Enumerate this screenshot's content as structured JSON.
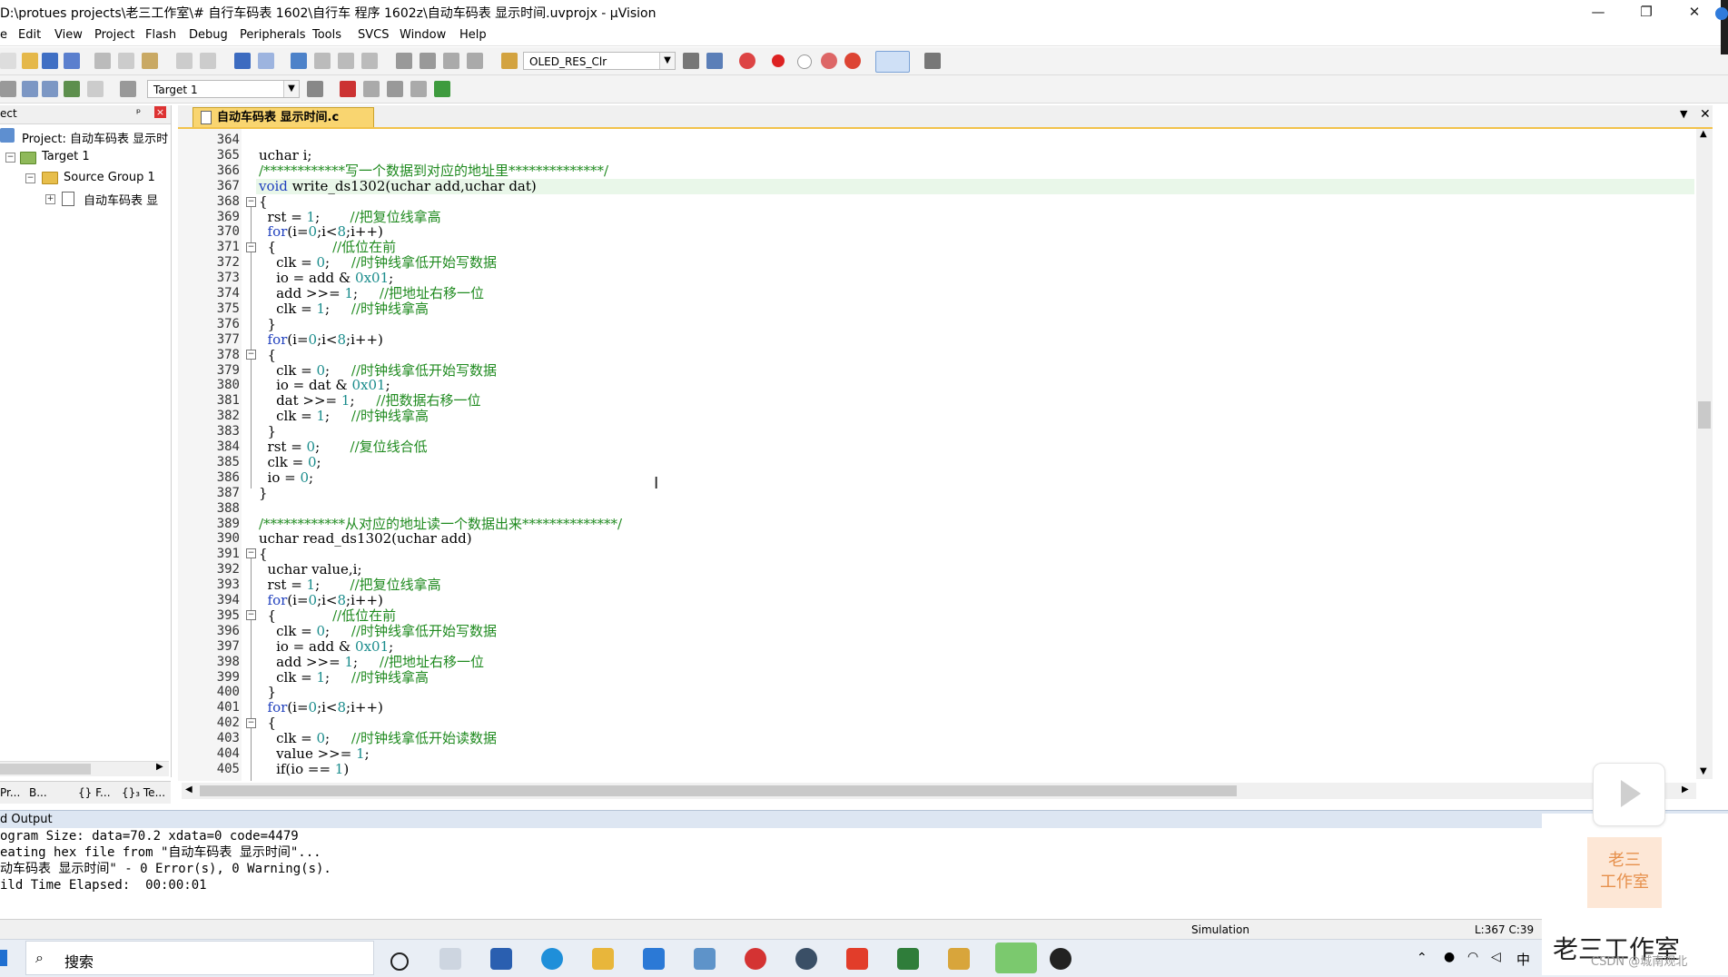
{
  "window": {
    "title": "D:\\protues projects\\老三工作室\\# 自行车码表  1602\\自行车 程序 1602z\\自动车码表 显示时间.uvprojx - µVision",
    "min": "—",
    "restore": "❐",
    "close": "✕"
  },
  "menu": [
    "e",
    "Edit",
    "View",
    "Project",
    "Flash",
    "Debug",
    "Peripherals",
    "Tools",
    "SVCS",
    "Window",
    "Help"
  ],
  "toolbar": {
    "target_combo": "OLED_RES_Clr",
    "build_target": "Target 1"
  },
  "project": {
    "header": "ect",
    "pin": "ᵖ",
    "close": "×",
    "root": "Project: 自动车码表 显示时",
    "target": "Target 1",
    "group": "Source Group 1",
    "file": "自动车码表 显",
    "tabs": [
      "Pr...",
      "B...",
      "{} F...",
      "{}₃ Te..."
    ]
  },
  "editor": {
    "tab": "自动车码表 显示时间.c",
    "lines": [
      {
        "n": "364",
        "html": ""
      },
      {
        "n": "365",
        "html": "uchar i;"
      },
      {
        "n": "366",
        "html": "<span class='cm'>/************写一个数据到对应的地址里**************/</span>"
      },
      {
        "n": "367",
        "html": "<span class='kw'>void</span> write_ds1302(uchar add,uchar dat)"
      },
      {
        "n": "368",
        "html": "{"
      },
      {
        "n": "369",
        "html": "  rst = <span class='num'>1</span>;       <span class='cm'>//把复位线拿高</span>"
      },
      {
        "n": "370",
        "html": "  <span class='kw'>for</span>(i=<span class='num'>0</span>;i&lt;<span class='num'>8</span>;i++)"
      },
      {
        "n": "371",
        "html": "  {             <span class='cm'>//低位在前</span>"
      },
      {
        "n": "372",
        "html": "    clk = <span class='num'>0</span>;     <span class='cm'>//时钟线拿低开始写数据</span>"
      },
      {
        "n": "373",
        "html": "    io = add &amp; <span class='num'>0x01</span>;"
      },
      {
        "n": "374",
        "html": "    add &gt;&gt;= <span class='num'>1</span>;     <span class='cm'>//把地址右移一位</span>"
      },
      {
        "n": "375",
        "html": "    clk = <span class='num'>1</span>;     <span class='cm'>//时钟线拿高</span>"
      },
      {
        "n": "376",
        "html": "  }"
      },
      {
        "n": "377",
        "html": "  <span class='kw'>for</span>(i=<span class='num'>0</span>;i&lt;<span class='num'>8</span>;i++)"
      },
      {
        "n": "378",
        "html": "  {"
      },
      {
        "n": "379",
        "html": "    clk = <span class='num'>0</span>;     <span class='cm'>//时钟线拿低开始写数据</span>"
      },
      {
        "n": "380",
        "html": "    io = dat &amp; <span class='num'>0x01</span>;"
      },
      {
        "n": "381",
        "html": "    dat &gt;&gt;= <span class='num'>1</span>;     <span class='cm'>//把数据右移一位</span>"
      },
      {
        "n": "382",
        "html": "    clk = <span class='num'>1</span>;     <span class='cm'>//时钟线拿高</span>"
      },
      {
        "n": "383",
        "html": "  }"
      },
      {
        "n": "384",
        "html": "  rst = <span class='num'>0</span>;       <span class='cm'>//复位线合低</span>"
      },
      {
        "n": "385",
        "html": "  clk = <span class='num'>0</span>;"
      },
      {
        "n": "386",
        "html": "  io = <span class='num'>0</span>;"
      },
      {
        "n": "387",
        "html": "}"
      },
      {
        "n": "388",
        "html": ""
      },
      {
        "n": "389",
        "html": "<span class='cm'>/************从对应的地址读一个数据出来**************/</span>"
      },
      {
        "n": "390",
        "html": "uchar read_ds1302(uchar add)"
      },
      {
        "n": "391",
        "html": "{"
      },
      {
        "n": "392",
        "html": "  uchar value,i;"
      },
      {
        "n": "393",
        "html": "  rst = <span class='num'>1</span>;       <span class='cm'>//把复位线拿高</span>"
      },
      {
        "n": "394",
        "html": "  <span class='kw'>for</span>(i=<span class='num'>0</span>;i&lt;<span class='num'>8</span>;i++)"
      },
      {
        "n": "395",
        "html": "  {             <span class='cm'>//低位在前</span>"
      },
      {
        "n": "396",
        "html": "    clk = <span class='num'>0</span>;     <span class='cm'>//时钟线拿低开始写数据</span>"
      },
      {
        "n": "397",
        "html": "    io = add &amp; <span class='num'>0x01</span>;"
      },
      {
        "n": "398",
        "html": "    add &gt;&gt;= <span class='num'>1</span>;     <span class='cm'>//把地址右移一位</span>"
      },
      {
        "n": "399",
        "html": "    clk = <span class='num'>1</span>;     <span class='cm'>//时钟线拿高</span>"
      },
      {
        "n": "400",
        "html": "  }"
      },
      {
        "n": "401",
        "html": "  <span class='kw'>for</span>(i=<span class='num'>0</span>;i&lt;<span class='num'>8</span>;i++)"
      },
      {
        "n": "402",
        "html": "  {"
      },
      {
        "n": "403",
        "html": "    clk = <span class='num'>0</span>;     <span class='cm'>//时钟线拿低开始读数据</span>"
      },
      {
        "n": "404",
        "html": "    value &gt;&gt;= <span class='num'>1</span>;"
      },
      {
        "n": "405",
        "html": "    if(io == <span class='num'>1</span>)"
      }
    ]
  },
  "output": {
    "title": "d Output",
    "lines": [
      "ogram Size: data=70.2 xdata=0 code=4479",
      "eating hex file from \"自动车码表 显示时间\"...",
      "动车码表 显示时间\" - 0 Error(s), 0 Warning(s).",
      "ild Time Elapsed:  00:00:01"
    ]
  },
  "status": {
    "mode": "Simulation",
    "pos": "L:367 C:39"
  },
  "taskbar": {
    "search": "搜索",
    "ime": "中"
  },
  "watermark": {
    "logo": "老三\n工作室",
    "text": "老三工作室",
    "csdn": "CSDN @城南观北"
  },
  "colors": {
    "accent": "#f9d570",
    "keyword": "#1f3fbd",
    "comment": "#1f8a1f",
    "number": "#1a8c8c"
  }
}
